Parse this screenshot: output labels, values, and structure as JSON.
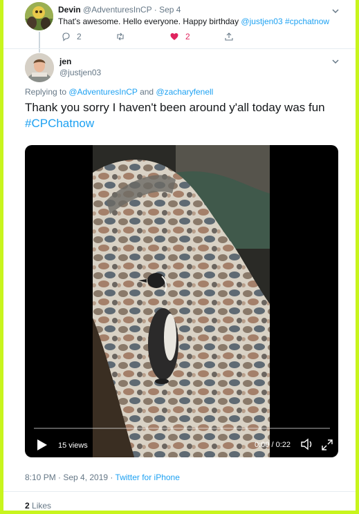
{
  "colors": {
    "border_accent": "#c8f51d",
    "link": "#1da1f2",
    "muted": "#657786",
    "like": "#e0245e"
  },
  "tweet_parent": {
    "author_name": "Devin",
    "author_handle": "@AdventuresInCP",
    "date_sep": " · ",
    "date": "Sep 4",
    "text_prefix": "That's awesome. Hello everyone. Happy birthday ",
    "mention": "@justjen03",
    "hashtag": "#cpchatnow",
    "reply_count": "2",
    "retweet_count": "",
    "like_count": "2",
    "liked": true,
    "icons": [
      "reply-icon",
      "retweet-icon",
      "heart-icon",
      "share-icon",
      "chevron-down-icon"
    ]
  },
  "tweet_main": {
    "author_name": "jen",
    "author_handle": "@justjen03",
    "replying_label": "Replying to ",
    "replying_user1": "@AdventuresInCP",
    "replying_and": " and ",
    "replying_user2": "@zacharyfenell",
    "text": "Thank you sorry I haven't been around y'all today was fun ",
    "hashtag": "#CPChatnow",
    "video": {
      "views": "15 views",
      "time": "0:00 / 0:22",
      "progress": 0,
      "icons": [
        "play-icon",
        "volume-icon",
        "fullscreen-icon"
      ]
    },
    "timestamp": "8:10 PM · Sep 4, 2019",
    "meta_sep": " · ",
    "source": "Twitter for iPhone",
    "likes_count": "2",
    "likes_label": "Likes"
  }
}
